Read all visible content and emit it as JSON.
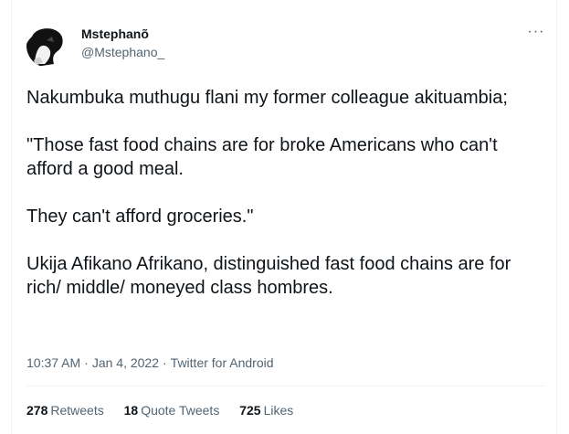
{
  "author": {
    "display_name": "Mstephanõ",
    "handle": "@Mstephano_",
    "avatar_icon": "silhouette-avatar"
  },
  "menu": {
    "more_icon": "more-horizontal-icon",
    "more_glyph": "···"
  },
  "tweet": {
    "paragraphs": [
      "Nakumbuka muthugu flani my former colleague akituambia;",
      "\"Those fast food chains are for broke Americans who can't afford a good meal.",
      "They can't afford groceries.\"",
      "Ukija Afikano Afrikano, distinguished fast food chains are for rich/ middle/ moneyed class hombres."
    ]
  },
  "meta": {
    "time": "10:37 AM",
    "separator": "·",
    "date": "Jan 4, 2022",
    "source": "Twitter for Android"
  },
  "stats": {
    "retweets": {
      "count": "278",
      "label": "Retweets"
    },
    "quote_tweets": {
      "count": "18",
      "label": "Quote Tweets"
    },
    "likes": {
      "count": "725",
      "label": "Likes"
    }
  },
  "colors": {
    "text_primary": "#0f1419",
    "text_secondary": "#536471",
    "border": "#eff3f4"
  }
}
